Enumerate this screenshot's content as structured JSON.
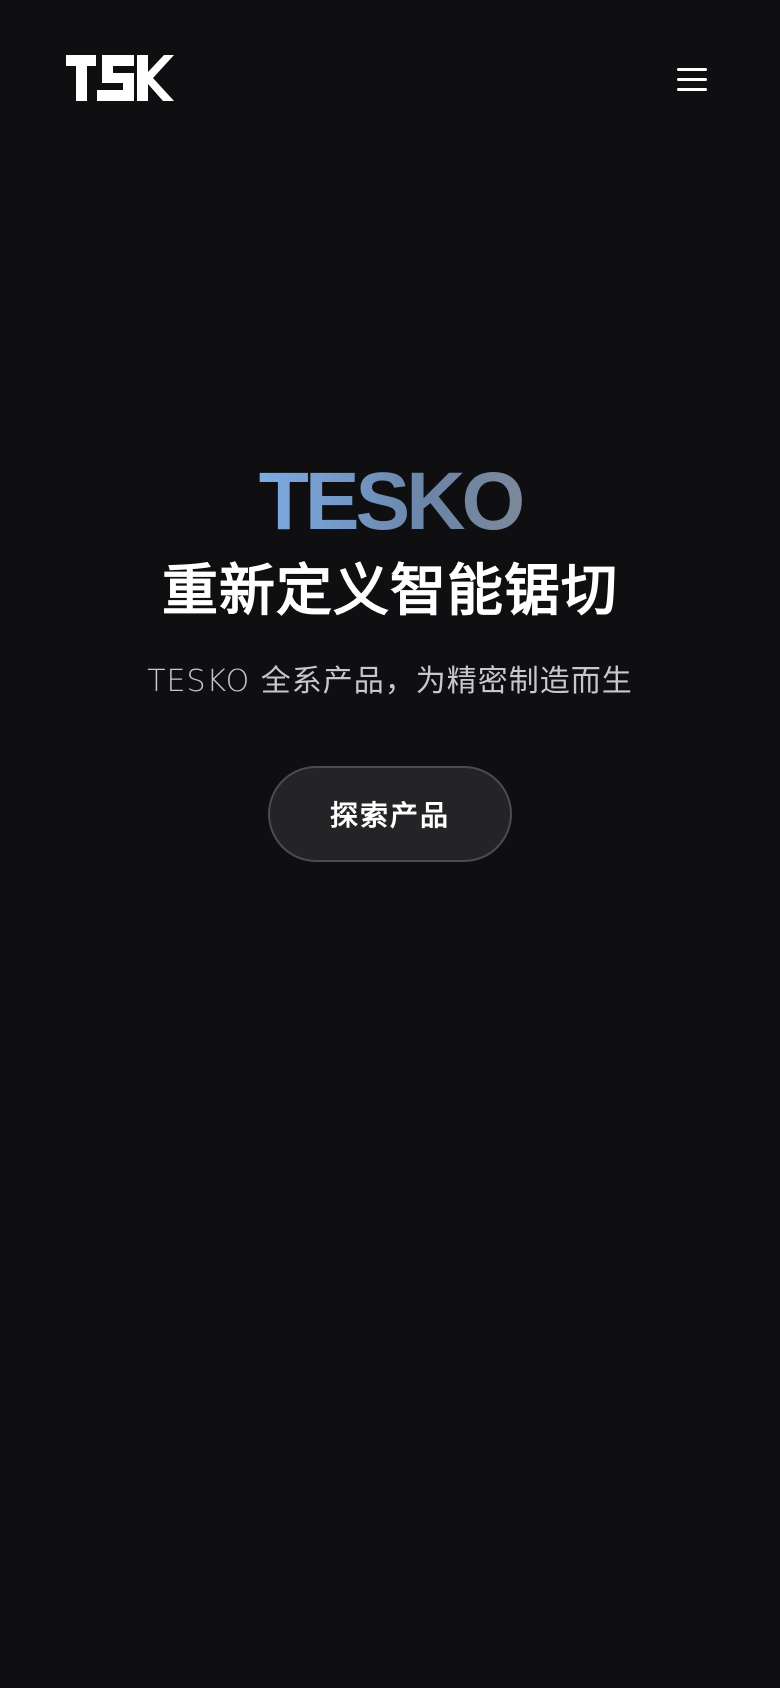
{
  "header": {
    "logo_text": "TSK",
    "menu_icon": "hamburger-menu-icon"
  },
  "hero": {
    "brand": "TESKO",
    "headline": "重新定义智能锯切",
    "tagline": "TESKO 全系产品，为精密制造而生",
    "cta_label": "探索产品"
  },
  "colors": {
    "background": "#0f0f11",
    "text": "#ffffff",
    "tagline": "#c8c8cc",
    "button_fill": "#242427",
    "button_border": "#4c4c50",
    "brand_gradient": [
      "#c8e0ff",
      "#7fb1ee",
      "#6b85a6",
      "#8c8c92",
      "#c9c9cc"
    ]
  }
}
